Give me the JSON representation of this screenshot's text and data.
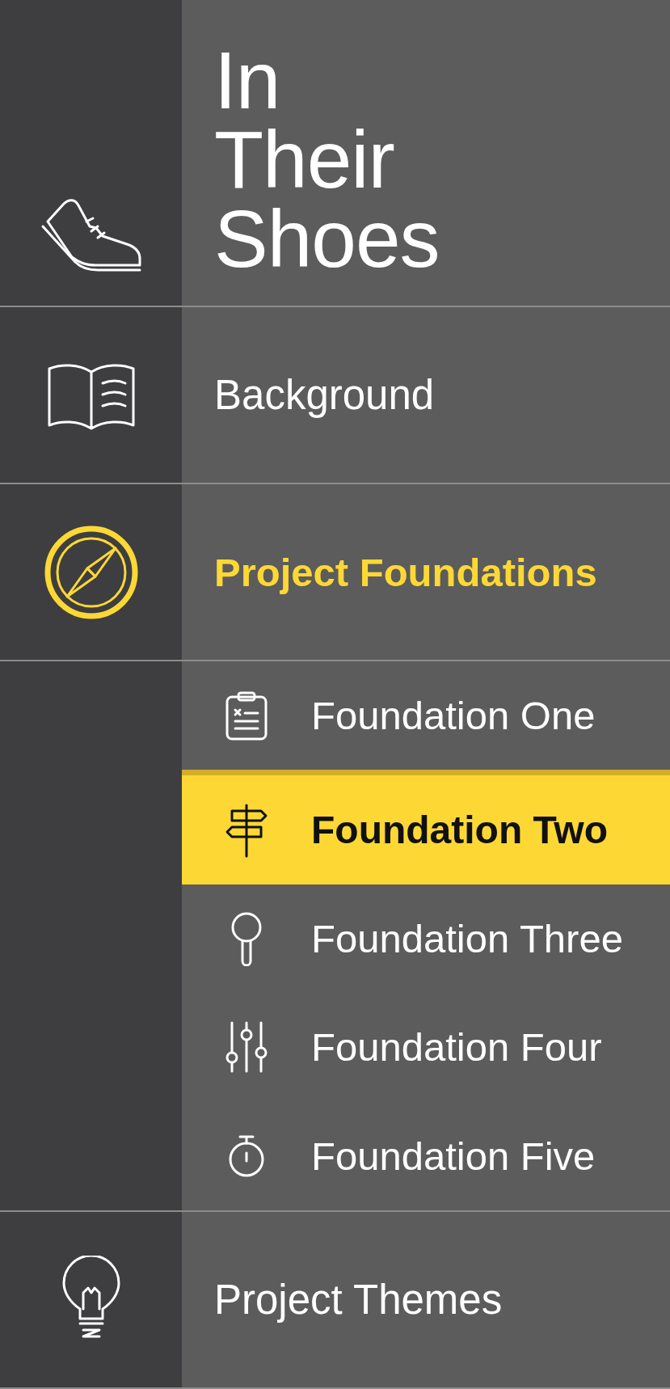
{
  "title": "In Their Shoes",
  "sections": [
    {
      "label": "Background",
      "selected": false
    },
    {
      "label": "Project Foundations",
      "selected": true,
      "expanded": true,
      "children": [
        {
          "label": "Foundation One",
          "selected": false
        },
        {
          "label": "Foundation Two",
          "selected": true
        },
        {
          "label": "Foundation Three",
          "selected": false
        },
        {
          "label": "Foundation Four",
          "selected": false
        },
        {
          "label": "Foundation Five",
          "selected": false
        }
      ]
    },
    {
      "label": "Project Themes",
      "selected": false
    }
  ]
}
